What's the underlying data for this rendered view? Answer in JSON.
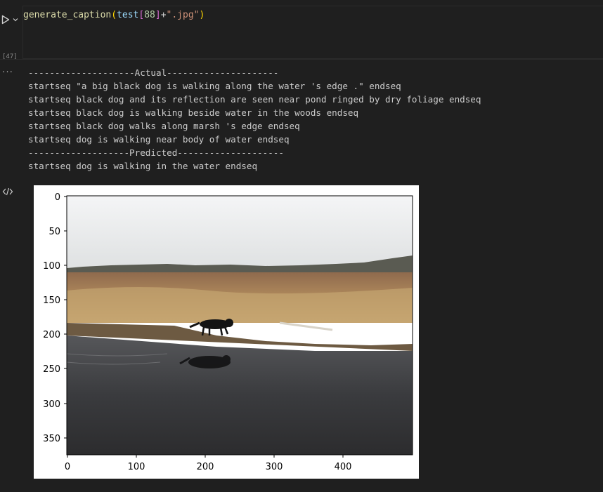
{
  "cell": {
    "execution_count": "[47]",
    "code": {
      "fn": "generate_caption",
      "open_paren": "(",
      "var": "test",
      "open_bracket": "[",
      "index": "88",
      "close_bracket": "]",
      "op": "+",
      "str": "\".jpg\"",
      "close_paren": ")"
    }
  },
  "output": {
    "more_label": "···",
    "lines": [
      "--------------------Actual---------------------",
      "startseq \"a big black dog is walking along the water 's edge .\" endseq",
      "startseq black dog and its reflection are seen near pond ringed by dry foliage endseq",
      "startseq black dog is walking beside water in the woods endseq",
      "startseq black dog walks along marsh 's edge endseq",
      "startseq dog is walking near body of water endseq",
      "-------------------Predicted--------------------",
      "startseq dog is walking in the water endseq"
    ]
  },
  "figure": {
    "x_ticks": [
      "0",
      "100",
      "200",
      "300",
      "400"
    ],
    "y_ticks": [
      "0",
      "50",
      "100",
      "150",
      "200",
      "250",
      "300",
      "350"
    ],
    "image_subject": "black dog walking along marsh water edge"
  },
  "colors": {
    "background": "#1f1f1f",
    "fn": "#dcdcaa",
    "var": "#9cdcfe",
    "string": "#ce9178",
    "number": "#b5cea8"
  }
}
